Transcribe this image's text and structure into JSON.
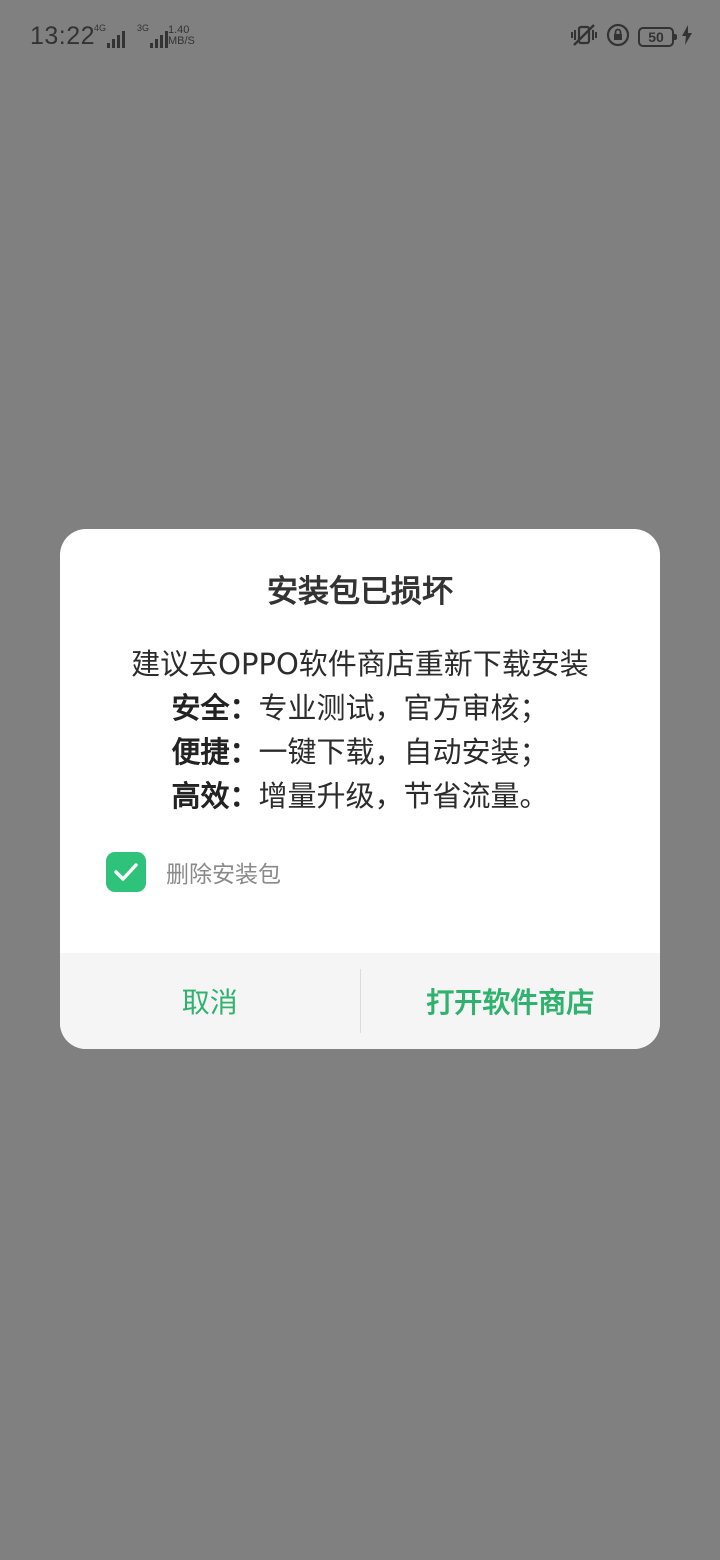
{
  "status_bar": {
    "time": "13:22",
    "network1": "4G",
    "network2": "3G",
    "speed_value": "1.40",
    "speed_unit": "MB/S",
    "battery": "50",
    "icons": [
      "vibrate-mute-icon",
      "rotation-lock-icon",
      "battery-icon",
      "charging-icon"
    ]
  },
  "dialog": {
    "title": "安装包已损坏",
    "message_line1": "建议去OPPO软件商店重新下载安装",
    "features": [
      {
        "label": "安全：",
        "text": "专业测试，官方审核；"
      },
      {
        "label": "便捷：",
        "text": "一键下载，自动安装；"
      },
      {
        "label": "高效：",
        "text": "增量升级，节省流量。"
      }
    ],
    "checkbox_label": "删除安装包",
    "checkbox_checked": true,
    "cancel_label": "取消",
    "confirm_label": "打开软件商店"
  },
  "colors": {
    "accent": "#2fb26d",
    "checkbox": "#2fc27b",
    "scrim": "#808080"
  }
}
